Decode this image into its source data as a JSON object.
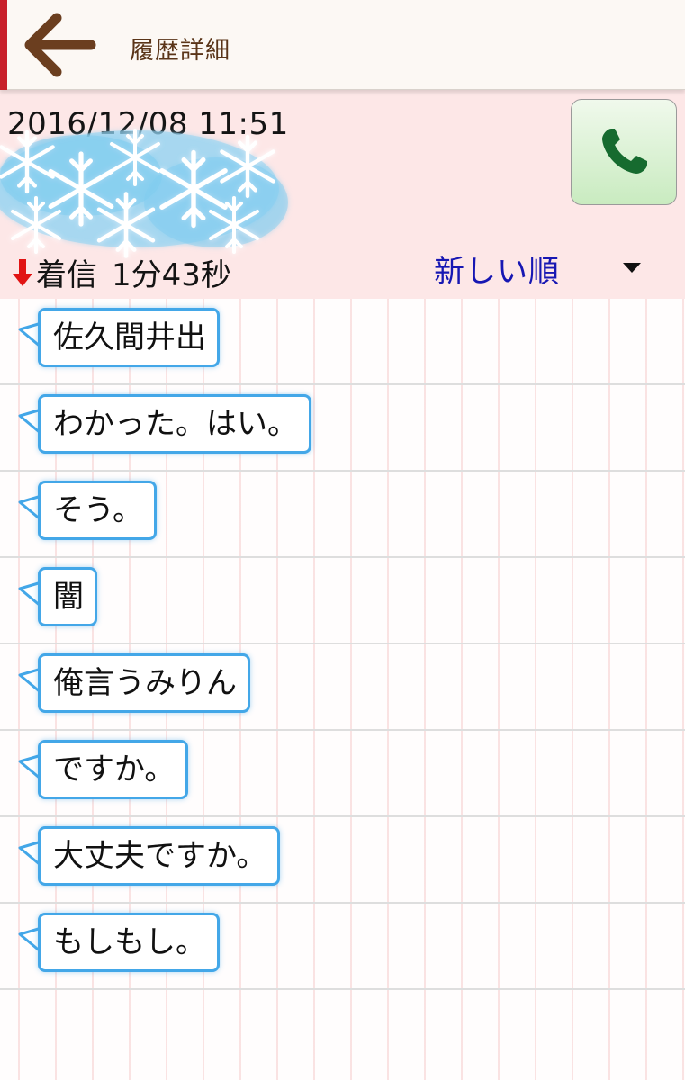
{
  "header": {
    "title": "履歴詳細"
  },
  "call": {
    "datetime": "2016/12/08 11:51",
    "direction": "着信",
    "duration": "1分43秒",
    "sort_label": "新しい順"
  },
  "colors": {
    "accent_red": "#c8202a",
    "title_brown": "#5a3418",
    "panel_pink": "#fde7e7",
    "bubble_border": "#43a7e8",
    "sort_blue": "#1717b3",
    "phone_green": "#166b2f"
  },
  "transcript": [
    "佐久間井出",
    "わかった。はい。",
    "そう。",
    "闇",
    "俺言うみりん",
    "ですか。",
    "大丈夫ですか。",
    "もしもし。"
  ]
}
